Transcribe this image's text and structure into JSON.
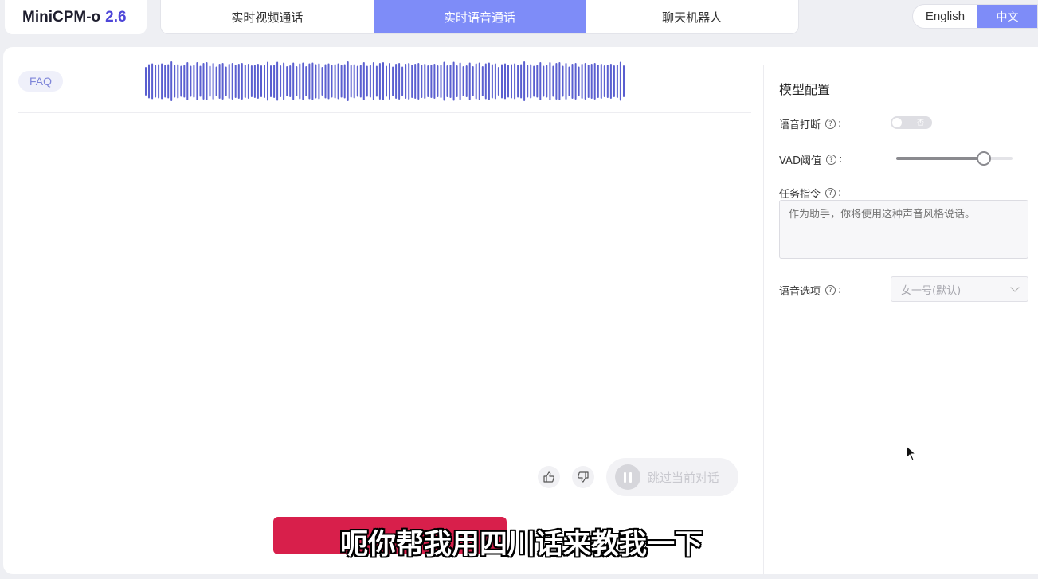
{
  "app": {
    "name": "MiniCPM-o",
    "version": "2.6"
  },
  "tabs": [
    {
      "label": "实时视频通话",
      "active": false
    },
    {
      "label": "实时语音通话",
      "active": true
    },
    {
      "label": "聊天机器人",
      "active": false
    }
  ],
  "language": {
    "english_label": "English",
    "chinese_label": "中文",
    "selected": "中文"
  },
  "main": {
    "faq_label": "FAQ",
    "skip_label": "跳过当前对话",
    "like_icon": "thumbs-up-icon",
    "dislike_icon": "thumbs-down-icon",
    "pause_icon": "pause-icon",
    "record_button_color": "#d81f4b"
  },
  "config": {
    "title": "模型配置",
    "voice_interrupt_label": "语音打断",
    "voice_interrupt_toggle_text": "否",
    "voice_interrupt_enabled": false,
    "vad_label": "VAD阈值",
    "vad_value": 0.75,
    "task_label": "任务指令",
    "task_placeholder": "作为助手，你将使用这种声音风格说话。",
    "voice_option_label": "语音选项",
    "voice_option_value": "女一号(默认)",
    "help_icon": "question-circle-icon",
    "help_glyph": "?"
  },
  "subtitle": "呃你帮我用四川话来教我一下",
  "colors": {
    "accent": "#7e8cf8",
    "brand": "#4e46d8",
    "waveform": "#5a5fd0",
    "record": "#d81f4b"
  }
}
